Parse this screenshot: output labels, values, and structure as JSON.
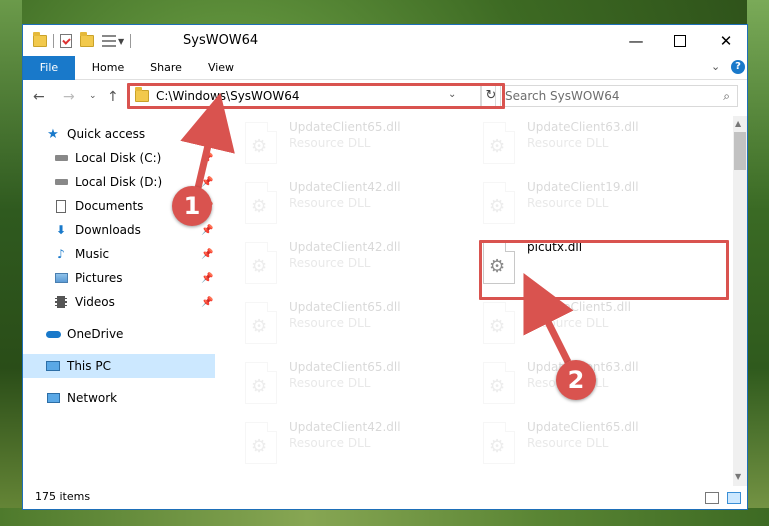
{
  "window": {
    "title": "SysWOW64"
  },
  "ribbon": {
    "tabs": [
      "File",
      "Home",
      "Share",
      "View"
    ],
    "help": "?"
  },
  "nav": {
    "address": "C:\\Windows\\SysWOW64",
    "search_placeholder": "Search SysWOW64"
  },
  "sidebar": {
    "items": [
      {
        "label": "Quick access",
        "icon": "star-icon"
      },
      {
        "label": "Local Disk (C:)",
        "icon": "drive-icon"
      },
      {
        "label": "Local Disk (D:)",
        "icon": "drive-icon"
      },
      {
        "label": "Documents",
        "icon": "documents-icon"
      },
      {
        "label": "Downloads",
        "icon": "download-icon"
      },
      {
        "label": "Music",
        "icon": "music-icon"
      },
      {
        "label": "Pictures",
        "icon": "pictures-icon"
      },
      {
        "label": "Videos",
        "icon": "videos-icon"
      },
      {
        "label": "OneDrive",
        "icon": "cloud-icon"
      },
      {
        "label": "This PC",
        "icon": "computer-icon"
      },
      {
        "label": "Network",
        "icon": "network-icon"
      }
    ]
  },
  "files": [
    {
      "name": "UpdateClient65.dll",
      "type": "Resource DLL"
    },
    {
      "name": "UpdateClient63.dll",
      "type": "Resource DLL"
    },
    {
      "name": "UpdateClient42.dll",
      "type": "Resource DLL"
    },
    {
      "name": "UpdateClient19.dll",
      "type": "Resource DLL"
    },
    {
      "name": "UpdateClient42.dll",
      "type": "Resource DLL"
    },
    {
      "name": "picutx.dll",
      "type": ""
    },
    {
      "name": "UpdateClient65.dll",
      "type": "Resource DLL"
    },
    {
      "name": "UpdateClient5.dll",
      "type": "Resource DLL"
    },
    {
      "name": "UpdateClient65.dll",
      "type": "Resource DLL"
    },
    {
      "name": "UpdateClient63.dll",
      "type": "Resource DLL"
    },
    {
      "name": "UpdateClient42.dll",
      "type": "Resource DLL"
    },
    {
      "name": "UpdateClient65.dll",
      "type": "Resource DLL"
    }
  ],
  "status": {
    "items_count": "175 items"
  },
  "callouts": {
    "one": "1",
    "two": "2"
  },
  "colors": {
    "accent": "#1979ca",
    "highlight": "#d9534f"
  }
}
